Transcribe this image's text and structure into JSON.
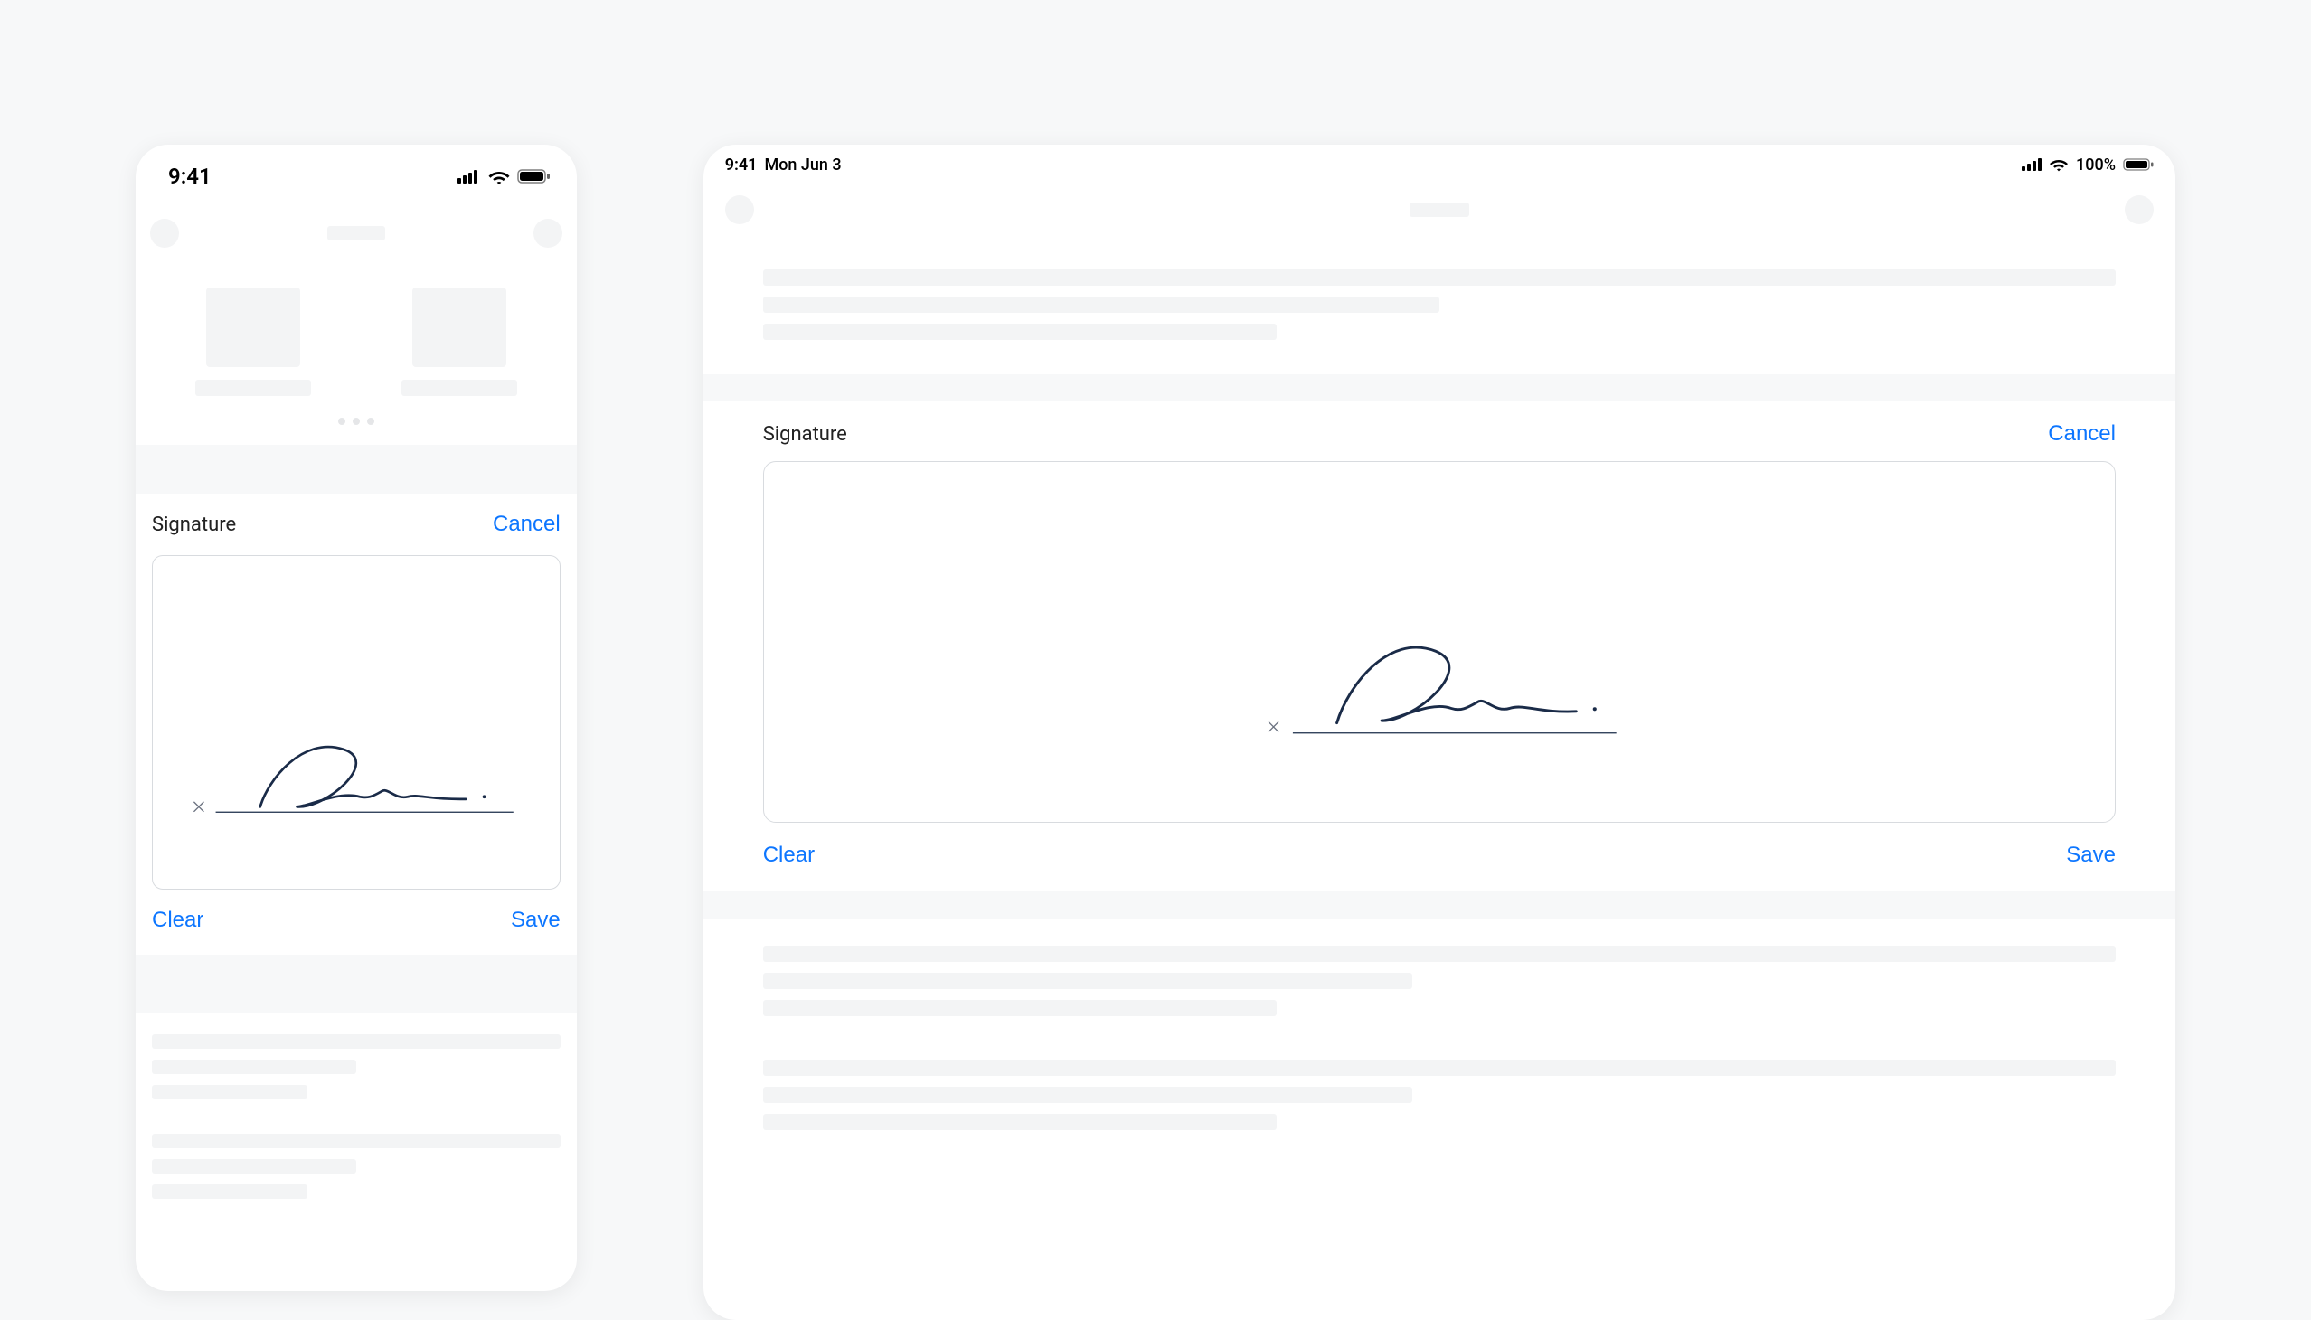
{
  "phone": {
    "status": {
      "time": "9:41"
    },
    "signature": {
      "title": "Signature",
      "cancel": "Cancel",
      "clear": "Clear",
      "save": "Save"
    }
  },
  "tablet": {
    "status": {
      "time": "9:41",
      "date": "Mon Jun 3",
      "battery_pct": "100%"
    },
    "signature": {
      "title": "Signature",
      "cancel": "Cancel",
      "clear": "Clear",
      "save": "Save"
    }
  }
}
